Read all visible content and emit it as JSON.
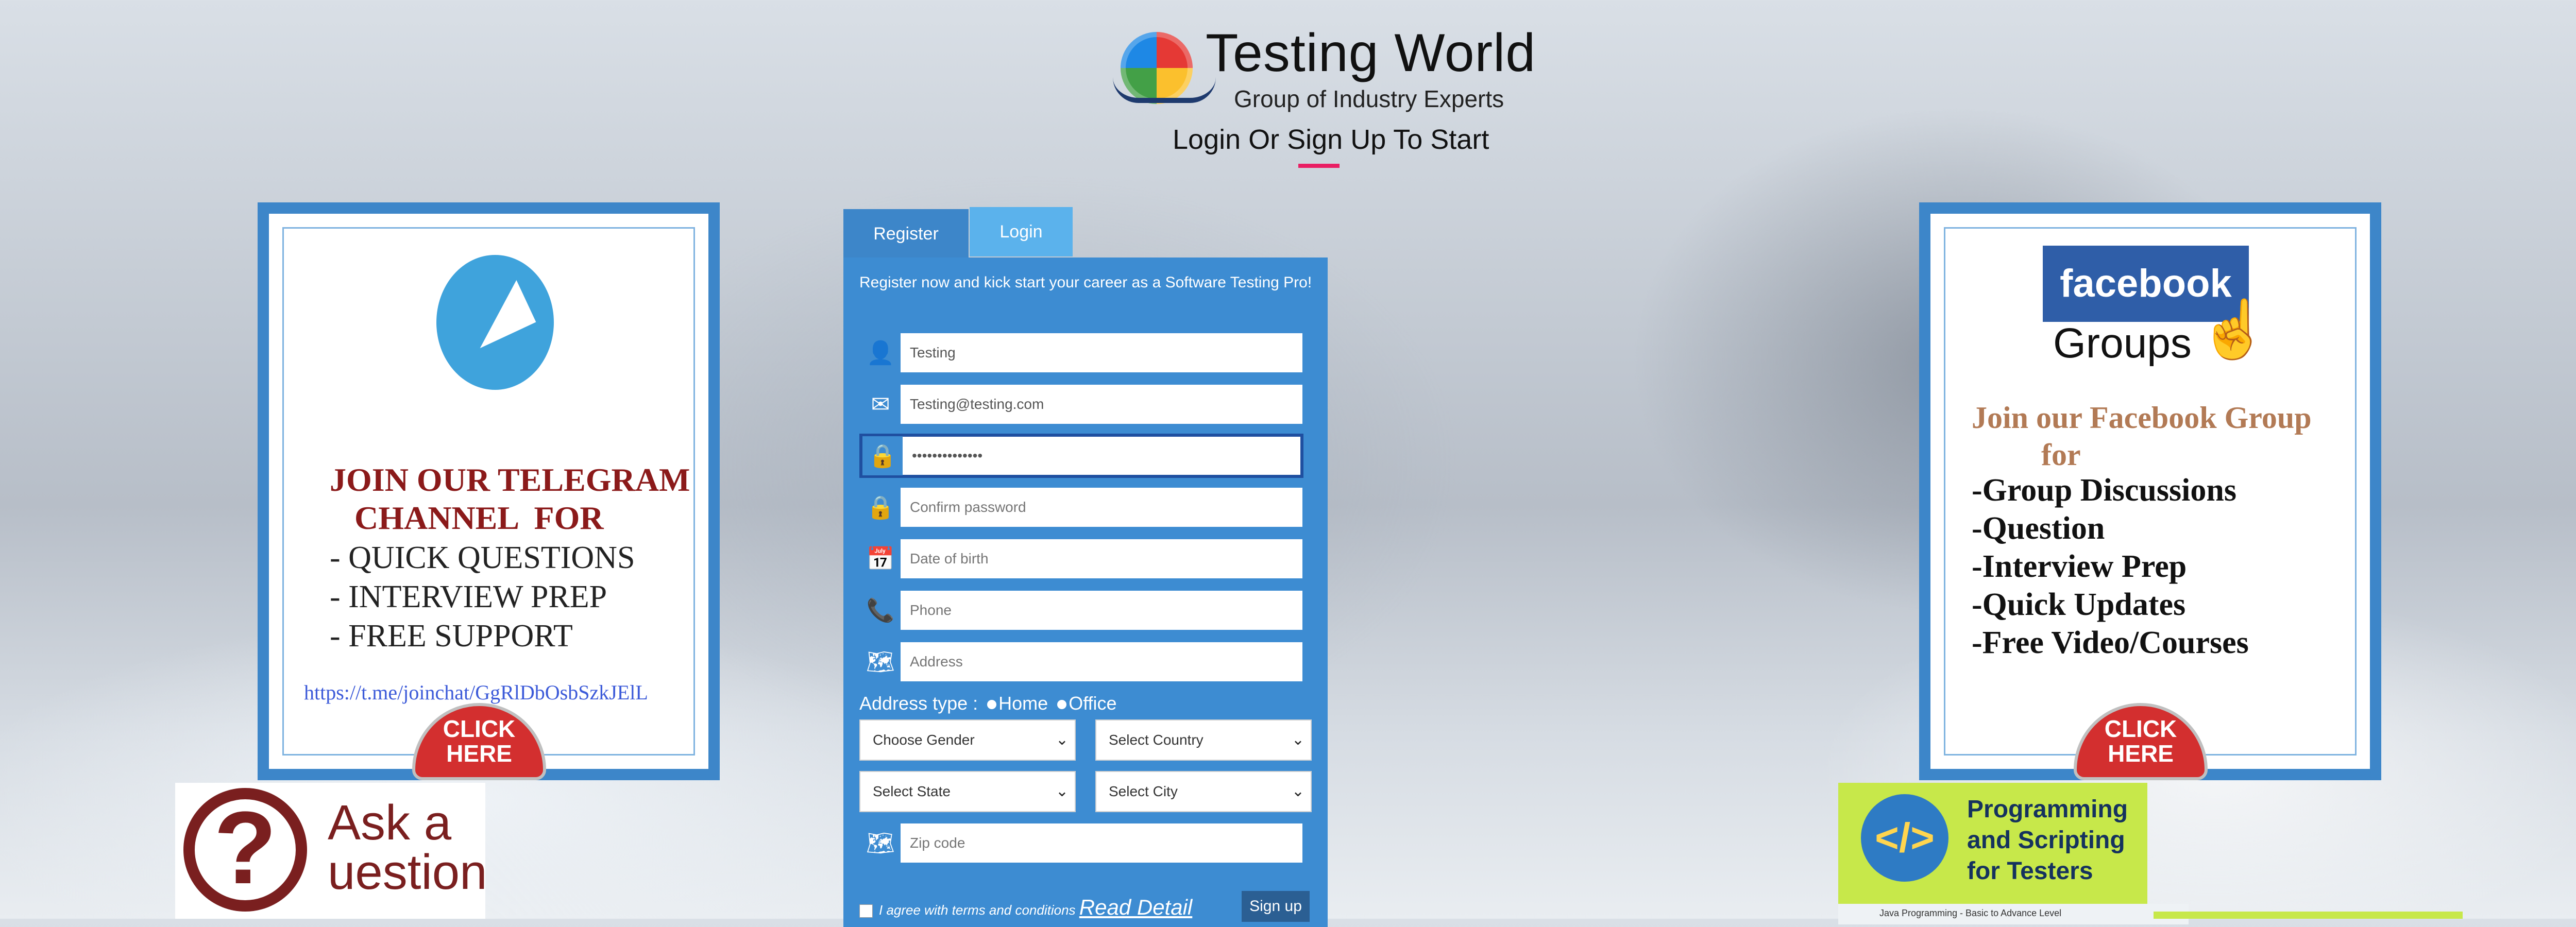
{
  "header": {
    "title": "Testing World",
    "subtitle": "Group of Industry Experts",
    "heading": "Login Or Sign Up To Start"
  },
  "telegram_card": {
    "headline": "JOIN OUR TELEGRAM\n   CHANNEL  FOR",
    "items": "- QUICK QUESTIONS\n- INTERVIEW PREP\n- FREE SUPPORT",
    "link": "https://t.me/joinchat/GgRlDbOsbSzkJElL",
    "click_here": "CLICK\nHERE"
  },
  "facebook_card": {
    "logo_text": "facebook",
    "groups_text": "Groups",
    "join_text": "Join our Facebook Group\n         for",
    "items": "-Group Discussions\n-Question\n-Interview Prep\n-Quick Updates\n-Free Video/Courses",
    "click_here": "CLICK\nHERE"
  },
  "tabs": {
    "register": "Register",
    "login": "Login"
  },
  "form": {
    "intro": "Register now and kick start your career as a Software Testing Pro!",
    "fields": {
      "name": {
        "value": "Testing",
        "icon": "user-icon"
      },
      "email": {
        "value": "Testing@testing.com",
        "icon": "envelope-icon"
      },
      "password": {
        "value": "••••••••••••••",
        "icon": "lock-icon"
      },
      "confirm_password": {
        "placeholder": "Confirm password",
        "icon": "lock-icon"
      },
      "dob": {
        "placeholder": "Date of birth",
        "icon": "calendar-icon"
      },
      "phone": {
        "placeholder": "Phone",
        "icon": "phone-icon"
      },
      "address": {
        "placeholder": "Address",
        "icon": "map-icon"
      },
      "zip": {
        "placeholder": "Zip code",
        "icon": "map-icon"
      }
    },
    "address_type_label": "Address type :",
    "address_options": [
      "Home",
      "Office"
    ],
    "selects": {
      "gender": "Choose Gender",
      "country": "Select Country",
      "state": "Select State",
      "city": "Select City"
    },
    "agree_text": "I agree with terms and conditions",
    "read_detail": "Read Detail",
    "signup_button": "Sign up"
  },
  "ask_banner": {
    "text": "Ask a\nuestion"
  },
  "prog_banner": {
    "text": "Programming\nand Scripting\nfor Testers",
    "strip": "Java Programming - Basic to Advance Level"
  },
  "colors": {
    "form_blue": "#3d8cd2",
    "tab_active": "#5bb2ec",
    "heading_underline": "#e91e63"
  }
}
